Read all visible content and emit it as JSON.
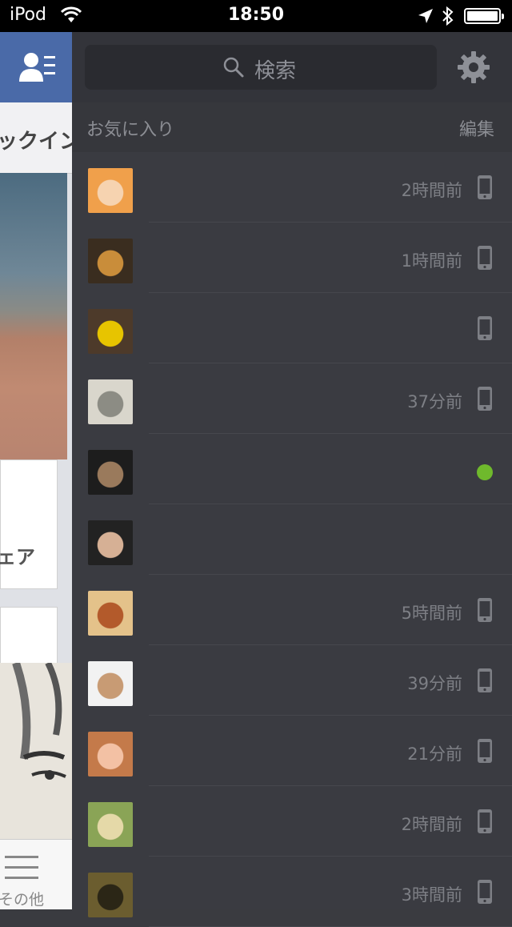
{
  "status_bar": {
    "carrier": "iPod",
    "time": "18:50"
  },
  "left_peek": {
    "checkin_text": "ックイン",
    "share_text": "ェア",
    "more_label": "その他"
  },
  "sidebar": {
    "search_placeholder": "検索",
    "section_title": "お気に入り",
    "edit_label": "編集",
    "favorites": [
      {
        "time": "2時間前",
        "status": "mobile",
        "avatar_colors": [
          "#f0a04b",
          "#f6d3b0"
        ]
      },
      {
        "time": "1時間前",
        "status": "mobile",
        "avatar_colors": [
          "#3a2d1f",
          "#c98d3a"
        ]
      },
      {
        "time": "",
        "status": "mobile",
        "avatar_colors": [
          "#4d3a2a",
          "#e7c400"
        ]
      },
      {
        "time": "37分前",
        "status": "mobile",
        "avatar_colors": [
          "#d9d6cc",
          "#8c8c84"
        ]
      },
      {
        "time": "",
        "status": "online",
        "avatar_colors": [
          "#1d1d1d",
          "#9a7a5c"
        ]
      },
      {
        "time": "",
        "status": "none",
        "avatar_colors": [
          "#222222",
          "#d6b095"
        ]
      },
      {
        "time": "5時間前",
        "status": "mobile",
        "avatar_colors": [
          "#e4c28a",
          "#b35a2b"
        ]
      },
      {
        "time": "39分前",
        "status": "mobile",
        "avatar_colors": [
          "#f2f2f2",
          "#c89b74"
        ]
      },
      {
        "time": "21分前",
        "status": "mobile",
        "avatar_colors": [
          "#c47a4a",
          "#f3c1a4"
        ]
      },
      {
        "time": "2時間前",
        "status": "mobile",
        "avatar_colors": [
          "#8aa456",
          "#e5d9a8"
        ]
      },
      {
        "time": "3時間前",
        "status": "mobile",
        "avatar_colors": [
          "#6b5d2f",
          "#2b2616"
        ]
      }
    ]
  }
}
